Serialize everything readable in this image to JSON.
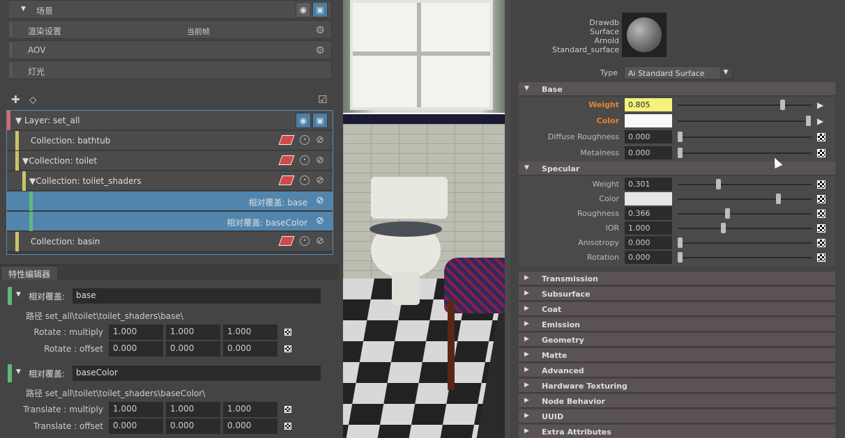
{
  "left": {
    "scene_label": "场景",
    "render_settings": {
      "label": "渲染设置",
      "value": "当前帧"
    },
    "aov_label": "AOV",
    "lights_label": "灯光",
    "tree": {
      "layer": "Layer:   set_all",
      "rows": [
        "Collection:   bathtub",
        "Collection:   toilet",
        "Collection:   toilet_shaders",
        "相对覆盖:   base",
        "相对覆盖:   baseColor",
        "Collection:   basin"
      ]
    },
    "attr_editor_tab": "特性编辑器",
    "override1": {
      "header": "相对覆盖:",
      "name": "base",
      "path": "路径  set_all\\toilet\\toilet_shaders\\base\\",
      "rows": [
        {
          "label": "Rotate : multiply",
          "values": [
            "1.000",
            "1.000",
            "1.000"
          ]
        },
        {
          "label": "Rotate : offset",
          "values": [
            "0.000",
            "0.000",
            "0.000"
          ]
        }
      ]
    },
    "override2": {
      "header": "相对覆盖:",
      "name": "baseColor",
      "path": "路径  set_all\\toilet\\toilet_shaders\\baseColor\\",
      "rows": [
        {
          "label": "Translate : multiply",
          "values": [
            "1.000",
            "1.000",
            "1.000"
          ]
        },
        {
          "label": "Translate : offset",
          "values": [
            "0.000",
            "0.000",
            "0.000"
          ]
        }
      ]
    }
  },
  "right": {
    "mat_names": [
      "Drawdb",
      "Surface",
      "Arnold",
      "Standard_surface"
    ],
    "type_label": "Type",
    "type_value": "Ai Standard Surface",
    "base": {
      "title": "Base",
      "rows": [
        {
          "label": "Weight",
          "value": "0.805",
          "level": 0.78
        },
        {
          "label": "Color",
          "value": "",
          "level": 0.98
        },
        {
          "label": "Diffuse Roughness",
          "value": "0.000",
          "level": 0
        },
        {
          "label": "Metalness",
          "value": "0.000",
          "level": 0
        }
      ]
    },
    "specular": {
      "title": "Specular",
      "rows": [
        {
          "label": "Weight",
          "value": "0.301",
          "level": 0.29
        },
        {
          "label": "Color",
          "value": "",
          "level": 0.75
        },
        {
          "label": "Roughness",
          "value": "0.366",
          "level": 0.36
        },
        {
          "label": "IOR",
          "value": "1.000",
          "level": 0.33
        },
        {
          "label": "Anisotropy",
          "value": "0.000",
          "level": 0
        },
        {
          "label": "Rotation",
          "value": "0.000",
          "level": 0
        }
      ]
    },
    "sections": [
      "Transmission",
      "Subsurface",
      "Coat",
      "Emission",
      "Geometry",
      "Matte",
      "Advanced",
      "Hardware Texturing",
      "Node Behavior",
      "UUID",
      "Extra Attributes"
    ]
  },
  "colors": {
    "accent_orange": "#e8842f",
    "selection_blue": "#5185ad",
    "override_green": "#5fb87a",
    "layer_red": "#d36a6a",
    "collection_yellow": "#c8c46a"
  }
}
